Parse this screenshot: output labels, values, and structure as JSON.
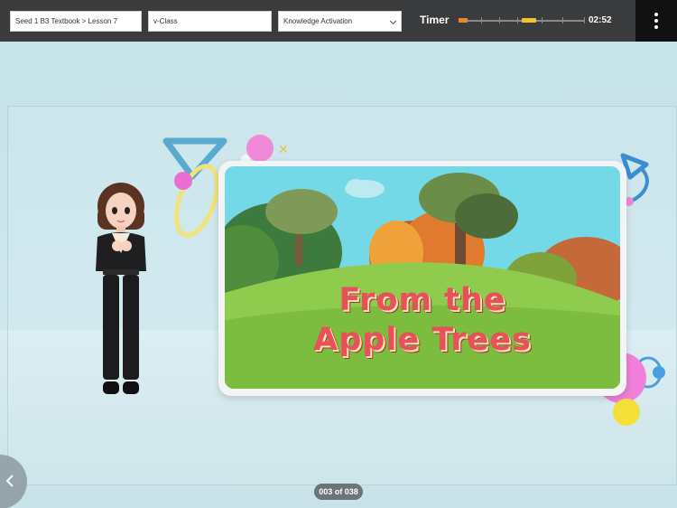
{
  "header": {
    "breadcrumb_field": "Seed 1 B3 Textbook > Lesson 7",
    "class_field": "v-Class",
    "activity_select": "Knowledge Activation",
    "timer_label": "Timer",
    "timer_value": "02:52",
    "menu_icon": "more-vertical-icon"
  },
  "slide": {
    "title_line1": "From the",
    "title_line2": "Apple Trees"
  },
  "footer": {
    "page_indicator": "003 of 038",
    "back_icon": "chevron-left-icon"
  }
}
